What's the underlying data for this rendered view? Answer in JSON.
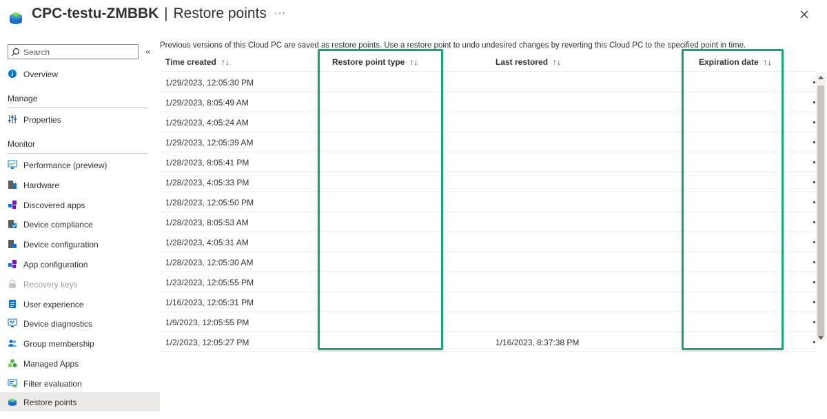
{
  "header": {
    "resource_name": "CPC-testu-ZMBBK",
    "separator": "|",
    "page_title": "Restore points",
    "more_label": "···"
  },
  "sidebar": {
    "search_placeholder": "Search",
    "collapse_label": "«",
    "top_items": [
      {
        "label": "Overview",
        "icon": "info-icon"
      }
    ],
    "manage_label": "Manage",
    "manage_items": [
      {
        "label": "Properties",
        "icon": "properties-icon"
      }
    ],
    "monitor_label": "Monitor",
    "monitor_items": [
      {
        "label": "Performance (preview)",
        "icon": "performance-icon"
      },
      {
        "label": "Hardware",
        "icon": "hardware-icon"
      },
      {
        "label": "Discovered apps",
        "icon": "apps-icon"
      },
      {
        "label": "Device compliance",
        "icon": "compliance-icon"
      },
      {
        "label": "Device configuration",
        "icon": "configuration-icon"
      },
      {
        "label": "App configuration",
        "icon": "app-config-icon"
      },
      {
        "label": "Recovery keys",
        "icon": "key-icon",
        "disabled": true
      },
      {
        "label": "User experience",
        "icon": "user-experience-icon"
      },
      {
        "label": "Device diagnostics",
        "icon": "diagnostics-icon"
      },
      {
        "label": "Group membership",
        "icon": "group-icon"
      },
      {
        "label": "Managed Apps",
        "icon": "managed-apps-icon"
      },
      {
        "label": "Filter evaluation",
        "icon": "filter-icon"
      },
      {
        "label": "Restore points",
        "icon": "restore-icon",
        "active": true
      }
    ]
  },
  "main": {
    "description": "Previous versions of this Cloud PC are saved as restore points. Use a restore point to undo undesired changes by reverting this Cloud PC to the specified point in time.",
    "columns": {
      "time_created": "Time created",
      "restore_point_type": "Restore point type",
      "last_restored": "Last restored",
      "expiration_date": "Expiration date",
      "sort_glyph": "↑↓"
    },
    "rows": [
      {
        "time_created": "1/29/2023, 12:05:30 PM",
        "restore_point_type": "",
        "last_restored": "",
        "expiration_date": ""
      },
      {
        "time_created": "1/29/2023, 8:05:49 AM",
        "restore_point_type": "",
        "last_restored": "",
        "expiration_date": ""
      },
      {
        "time_created": "1/29/2023, 4:05:24 AM",
        "restore_point_type": "",
        "last_restored": "",
        "expiration_date": ""
      },
      {
        "time_created": "1/29/2023, 12:05:39 AM",
        "restore_point_type": "",
        "last_restored": "",
        "expiration_date": ""
      },
      {
        "time_created": "1/28/2023, 8:05:41 PM",
        "restore_point_type": "",
        "last_restored": "",
        "expiration_date": ""
      },
      {
        "time_created": "1/28/2023, 4:05:33 PM",
        "restore_point_type": "",
        "last_restored": "",
        "expiration_date": ""
      },
      {
        "time_created": "1/28/2023, 12:05:50 PM",
        "restore_point_type": "",
        "last_restored": "",
        "expiration_date": ""
      },
      {
        "time_created": "1/28/2023, 8:05:53 AM",
        "restore_point_type": "",
        "last_restored": "",
        "expiration_date": ""
      },
      {
        "time_created": "1/28/2023, 4:05:31 AM",
        "restore_point_type": "",
        "last_restored": "",
        "expiration_date": ""
      },
      {
        "time_created": "1/28/2023, 12:05:30 AM",
        "restore_point_type": "",
        "last_restored": "",
        "expiration_date": ""
      },
      {
        "time_created": "1/23/2023, 12:05:55 PM",
        "restore_point_type": "",
        "last_restored": "",
        "expiration_date": ""
      },
      {
        "time_created": "1/16/2023, 12:05:31 PM",
        "restore_point_type": "",
        "last_restored": "",
        "expiration_date": ""
      },
      {
        "time_created": "1/9/2023, 12:05:55 PM",
        "restore_point_type": "",
        "last_restored": "",
        "expiration_date": ""
      },
      {
        "time_created": "1/2/2023, 12:05:27 PM",
        "restore_point_type": "",
        "last_restored": "1/16/2023, 8:37:38 PM",
        "expiration_date": ""
      }
    ]
  },
  "colors": {
    "highlight": "#1aa37a",
    "accent": "#0078d4",
    "active_nav_bg": "#edebe9"
  }
}
